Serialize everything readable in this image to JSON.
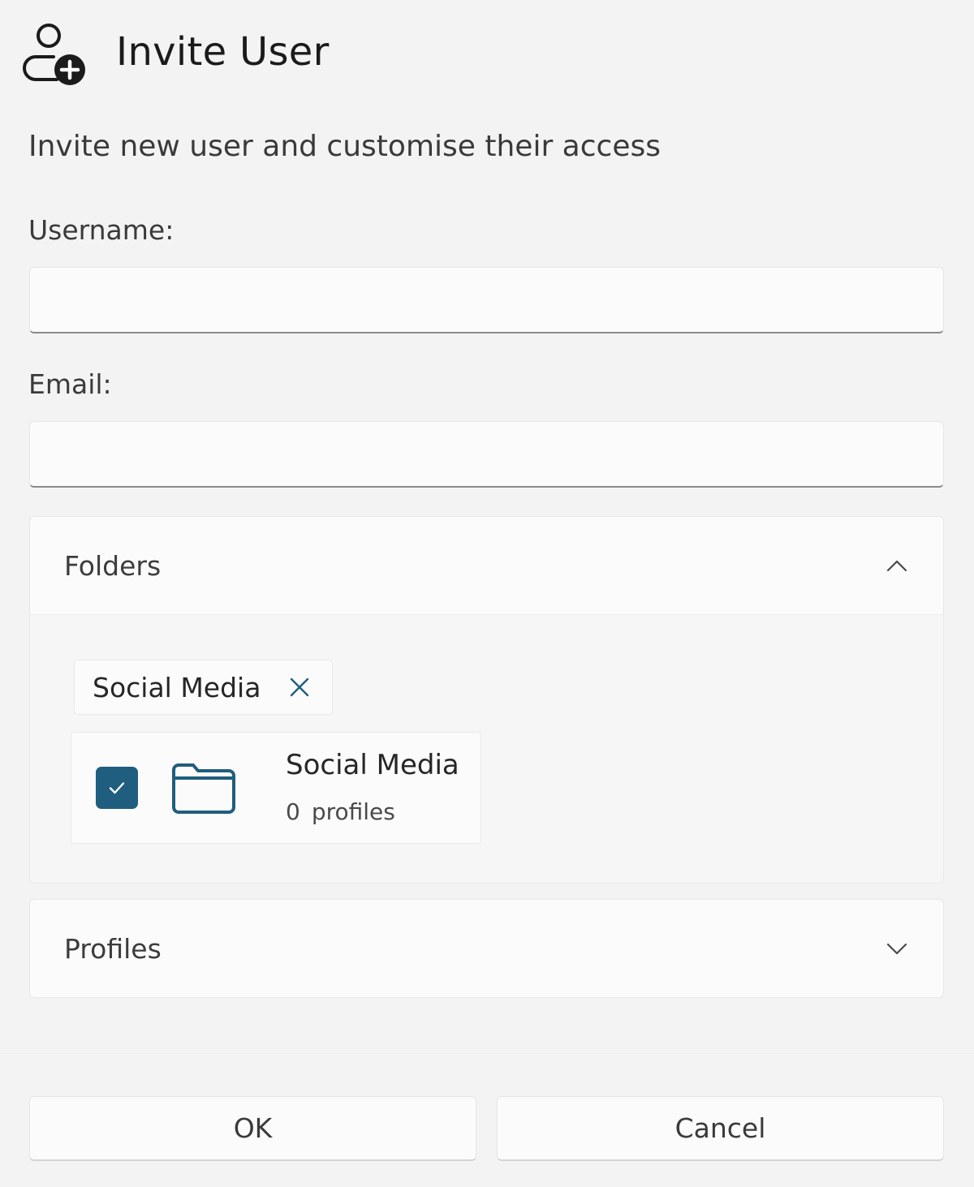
{
  "dialog": {
    "title": "Invite User",
    "subtitle": "Invite new user and customise their access",
    "header_icon": "user-add-icon"
  },
  "fields": {
    "username": {
      "label": "Username:",
      "value": "",
      "placeholder": ""
    },
    "email": {
      "label": "Email:",
      "value": "",
      "placeholder": ""
    }
  },
  "sections": {
    "folders": {
      "title": "Folders",
      "expanded": true,
      "selected_tags": [
        {
          "label": "Social Media"
        }
      ],
      "items": [
        {
          "name": "Social Media",
          "profile_count": "0",
          "profile_label": "profiles",
          "checked": true
        }
      ]
    },
    "profiles": {
      "title": "Profiles",
      "expanded": false
    }
  },
  "buttons": {
    "ok": "OK",
    "cancel": "Cancel"
  },
  "colors": {
    "accent": "#1f5e7e",
    "background": "#f3f3f3",
    "surface": "#fbfbfb"
  }
}
